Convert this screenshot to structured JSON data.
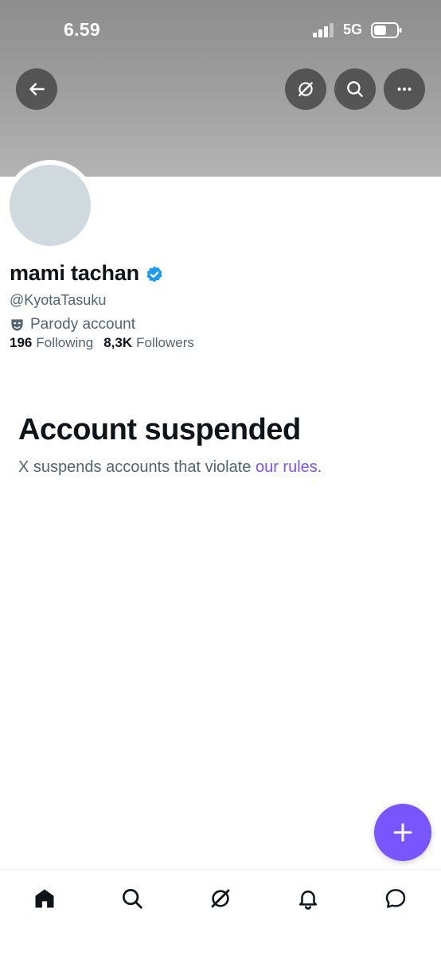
{
  "status_bar": {
    "time": "6.59",
    "network": "5G"
  },
  "header": {
    "back_icon": "arrow-left-icon",
    "grok_icon": "grok-icon",
    "search_icon": "search-icon",
    "more_icon": "more-horizontal-icon"
  },
  "profile": {
    "display_name": "mami tachan",
    "verified": true,
    "handle": "@KyotaTasuku",
    "parody_label": "Parody account",
    "following_count": "196",
    "following_label": "Following",
    "followers_count": "8,3K",
    "followers_label": "Followers"
  },
  "suspended": {
    "title": "Account suspended",
    "text": "X suspends accounts that violate ",
    "link": "our rules",
    "text_end": "."
  },
  "fab": {
    "icon": "plus-icon"
  },
  "bottom_nav": [
    {
      "name": "home",
      "icon": "home-icon"
    },
    {
      "name": "search",
      "icon": "search-icon"
    },
    {
      "name": "grok",
      "icon": "grok-icon"
    },
    {
      "name": "notifications",
      "icon": "bell-icon"
    },
    {
      "name": "messages",
      "icon": "chat-icon"
    }
  ],
  "colors": {
    "accent": "#7856ff",
    "verified": "#1d9bf0",
    "text_primary": "#0f1419",
    "text_secondary": "#536471",
    "avatar_placeholder": "#cfd9de"
  }
}
